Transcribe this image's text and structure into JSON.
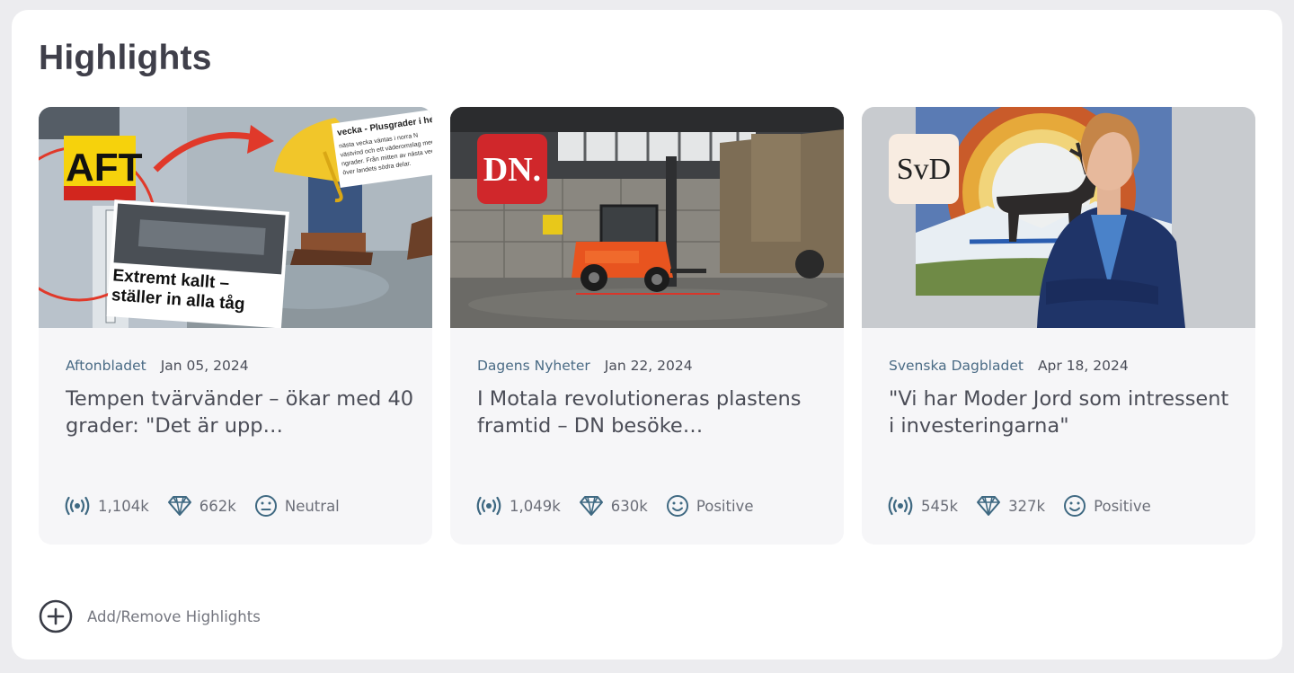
{
  "header": {
    "title": "Highlights"
  },
  "cards": [
    {
      "source": "Aftonbladet",
      "date": "Jan 05, 2024",
      "headline": "Tempen tvärvänder – ökar med 40 grader: \"Det är upp…",
      "reach": "1,104k",
      "value": "662k",
      "sentiment": "Neutral",
      "sentiment_icon": "neutral-face-icon",
      "logo_text": "AFT",
      "image_texts": {
        "headline1": "Extremt kallt –",
        "headline2": "ställer in alla tåg",
        "clip_title": "vecka - Plusgrader i hela",
        "clip_body1": "nästa vecka väntas i norra N",
        "clip_body2": "västvind och ett väderomslag med",
        "clip_body3": "ngrader. Från mitten av nästa vecka v",
        "clip_body4": "över landets södra delar."
      }
    },
    {
      "source": "Dagens Nyheter",
      "date": "Jan 22, 2024",
      "headline": "I Motala revolutioneras plastens framtid – DN besöke…",
      "reach": "1,049k",
      "value": "630k",
      "sentiment": "Positive",
      "sentiment_icon": "smile-face-icon",
      "logo_text": "DN."
    },
    {
      "source": "Svenska Dagbladet",
      "date": "Apr 18, 2024",
      "headline": "\"Vi har Moder Jord som intressent i investeringarna\"",
      "reach": "545k",
      "value": "327k",
      "sentiment": "Positive",
      "sentiment_icon": "smile-face-icon",
      "logo_text": "SvD"
    }
  ],
  "footer": {
    "add_remove_label": "Add/Remove Highlights"
  },
  "colors": {
    "background": "#ececef",
    "panel": "#ffffff",
    "card": "#f6f6f8",
    "source_text": "#4a6b85",
    "icon": "#3f6982",
    "dn_red": "#d0272b",
    "aft_yellow": "#f6d20c"
  },
  "icons": [
    "broadcast-icon",
    "diamond-icon",
    "neutral-face-icon",
    "smile-face-icon",
    "plus-circle-icon"
  ]
}
